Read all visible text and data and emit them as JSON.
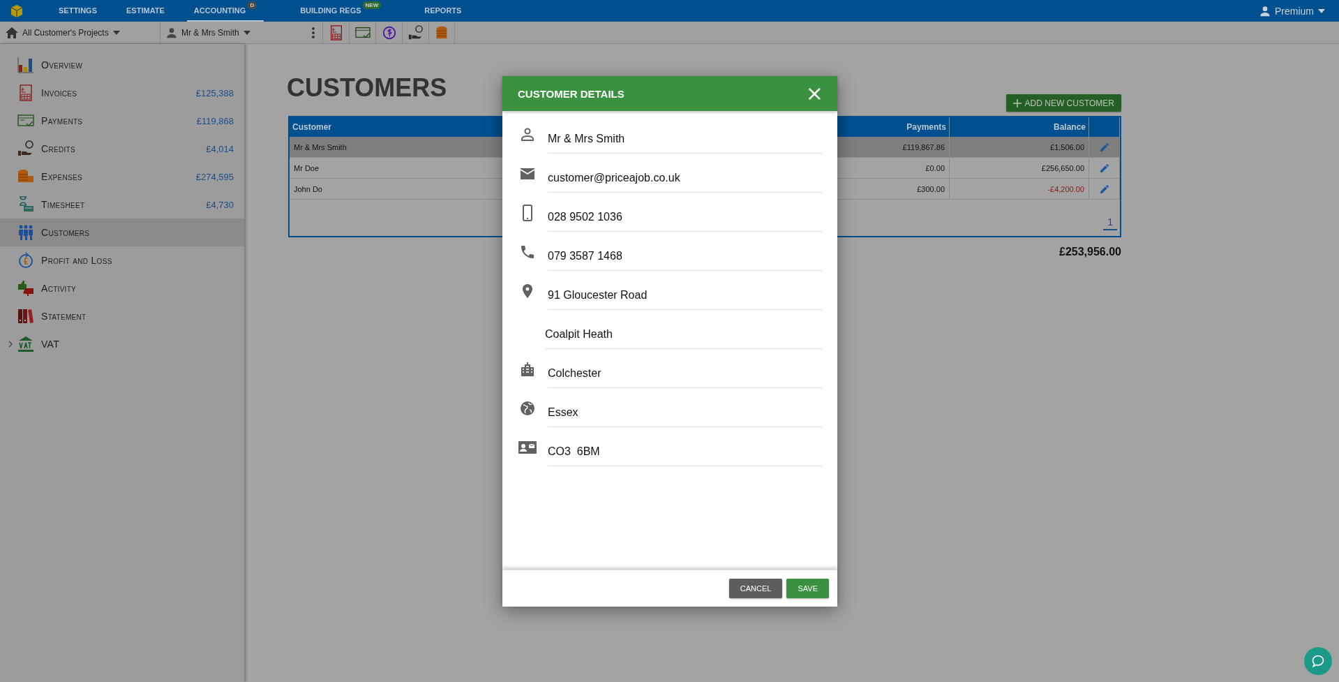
{
  "nav": {
    "tabs": [
      {
        "label": "SETTINGS",
        "selected": false
      },
      {
        "label": "ESTIMATE",
        "selected": false
      },
      {
        "label": "ACCOUNTING",
        "selected": true,
        "badge": {
          "text": "D",
          "color": "#4a4a4a"
        }
      },
      {
        "label": "BUILDING REGS",
        "selected": false,
        "badge": {
          "text": "NEW",
          "color": "#2f6a2f"
        }
      },
      {
        "label": "REPORTS",
        "selected": false
      }
    ],
    "user": "Premium"
  },
  "toolbar": {
    "project": "All Customer's Projects",
    "customer": "Mr & Mrs Smith"
  },
  "sidebar": {
    "items": [
      {
        "label": "Overview",
        "selected": false
      },
      {
        "label": "Invoices",
        "amount": "£125,388",
        "selected": false
      },
      {
        "label": "Payments",
        "amount": "£119,868",
        "selected": false
      },
      {
        "label": "Credits",
        "amount": "£4,014",
        "selected": false
      },
      {
        "label": "Expenses",
        "amount": "£274,595",
        "selected": false
      },
      {
        "label": "Timesheet",
        "amount": "£4,730",
        "selected": false
      },
      {
        "label": "Customers",
        "selected": true
      },
      {
        "label": "Profit and Loss",
        "selected": false
      },
      {
        "label": "Activity",
        "selected": false
      },
      {
        "label": "Statement",
        "selected": false
      },
      {
        "label": "VAT",
        "selected": false,
        "expanded": false
      }
    ]
  },
  "page": {
    "title": "CUSTOMERS",
    "add_button": "ADD NEW CUSTOMER",
    "table": {
      "columns": [
        "Customer",
        "Payments",
        "Balance"
      ],
      "rows": [
        {
          "customer": "Mr & Mrs Smith",
          "payments": "£119,867.86",
          "balance": "£1,506.00",
          "negative": false,
          "selected": true
        },
        {
          "customer": "Mr Doe",
          "payments": "£0.00",
          "balance": "£256,650.00",
          "negative": false,
          "selected": false
        },
        {
          "customer": "John Do",
          "payments": "£300.00",
          "balance": "-£4,200.00",
          "negative": true,
          "selected": false
        }
      ],
      "pages": [
        {
          "label": "1",
          "selected": true
        }
      ]
    },
    "total": "£253,956.00"
  },
  "dialog": {
    "title": "CUSTOMER DETAILS",
    "close": "×",
    "fields": [
      {
        "kind": "person",
        "value": "Mr & Mrs Smith"
      },
      {
        "kind": "email",
        "value": "customer@priceajob.co.uk"
      },
      {
        "kind": "mobile",
        "value": "028 9502 1036"
      },
      {
        "kind": "phone",
        "value": "079 3587 1468"
      },
      {
        "kind": "address",
        "value": "91 Gloucester Road"
      },
      {
        "kind": "address2",
        "value": "Coalpit Heath"
      },
      {
        "kind": "city",
        "value": "Colchester"
      },
      {
        "kind": "county",
        "value": "Essex"
      },
      {
        "kind": "postcode",
        "value": "CO3  6BM"
      }
    ],
    "buttons": [
      {
        "kind": "cancel",
        "label": "CANCEL"
      },
      {
        "kind": "save",
        "label": "SAVE"
      }
    ]
  }
}
